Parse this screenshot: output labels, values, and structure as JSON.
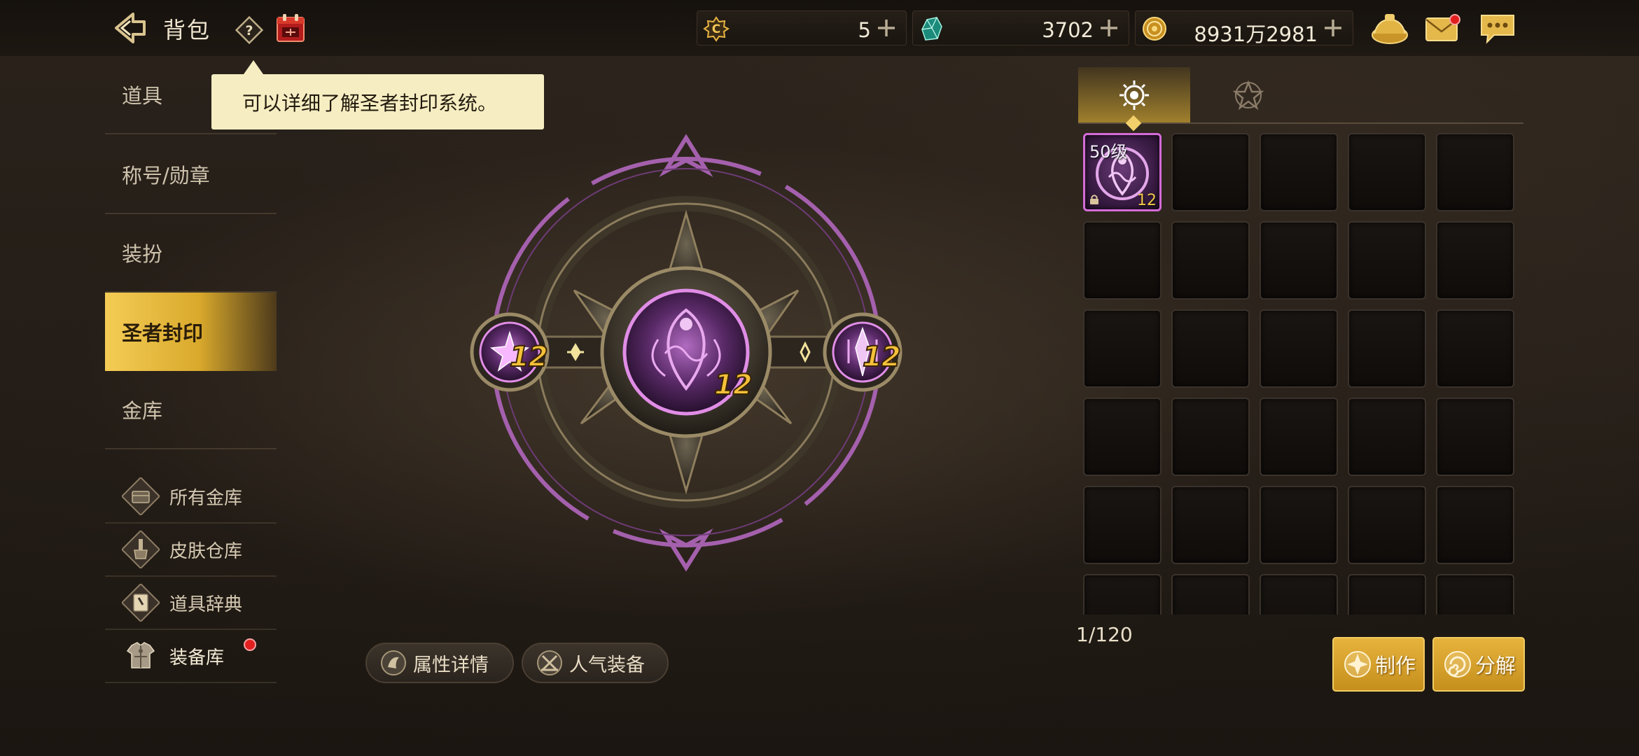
{
  "header": {
    "title": "背包",
    "currencies": [
      {
        "name": "coin-c",
        "value": "5"
      },
      {
        "name": "crystal",
        "value": "3702"
      },
      {
        "name": "gold",
        "value": "8931万2981"
      }
    ]
  },
  "nav": {
    "items": [
      {
        "label": "道具"
      },
      {
        "label": "称号/勋章"
      },
      {
        "label": "装扮"
      },
      {
        "label": "圣者封印"
      },
      {
        "label": "金库"
      }
    ],
    "sub_items": [
      {
        "label": "所有金库"
      },
      {
        "label": "皮肤仓库"
      },
      {
        "label": "道具辞典"
      },
      {
        "label": "装备库"
      }
    ]
  },
  "tooltip": {
    "text": "可以详细了解圣者封印系统。"
  },
  "seal": {
    "left_level": "12",
    "center_level": "12",
    "right_level": "12"
  },
  "buttons": {
    "attr_details": "属性详情",
    "popular_equip": "人气装备",
    "craft": "制作",
    "disassemble": "分解"
  },
  "inventory": {
    "first_item": {
      "level": "50级",
      "count": "12"
    },
    "capacity": "1/120"
  },
  "colors": {
    "accent_gold": "#d9a92c",
    "seal_purple": "#b26bbf",
    "notification_red": "#e21f1f"
  }
}
